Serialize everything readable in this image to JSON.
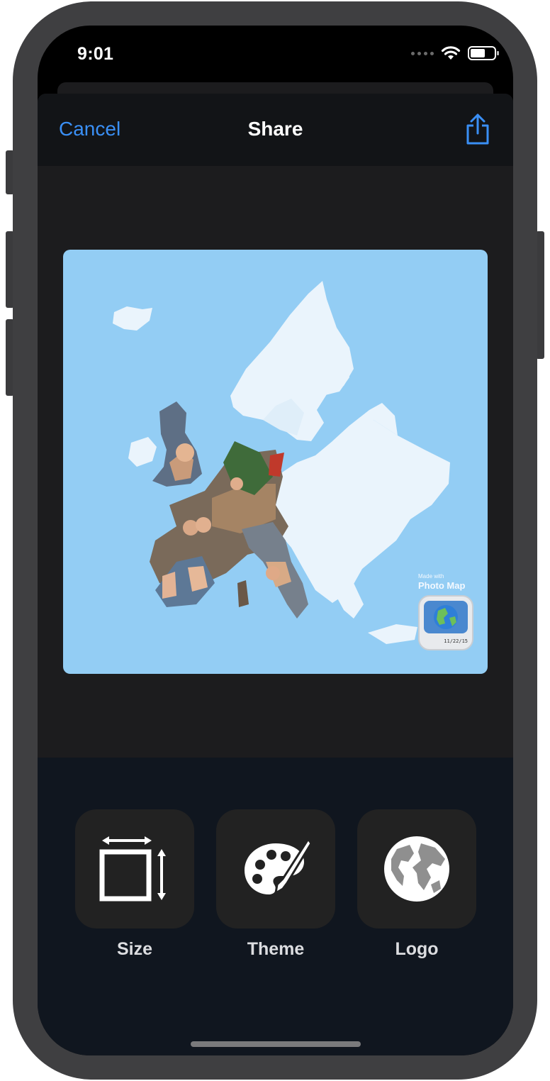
{
  "status_bar": {
    "time": "9:01"
  },
  "navbar": {
    "cancel_label": "Cancel",
    "title": "Share"
  },
  "preview": {
    "watermark_caption": "Made with",
    "watermark_app_name": "Photo Map",
    "app_icon_date": "11/22/15"
  },
  "toolbar": {
    "items": [
      {
        "label": "Size",
        "icon": "resize-icon"
      },
      {
        "label": "Theme",
        "icon": "palette-icon"
      },
      {
        "label": "Logo",
        "icon": "globe-icon"
      }
    ]
  },
  "colors": {
    "accent": "#3a8ff5",
    "map_water": "#93cdf4",
    "map_land": "#eaf4fc",
    "sheet_bg": "#1c1c1e",
    "toolbar_bg": "#10161f",
    "tile_bg": "#222222"
  }
}
